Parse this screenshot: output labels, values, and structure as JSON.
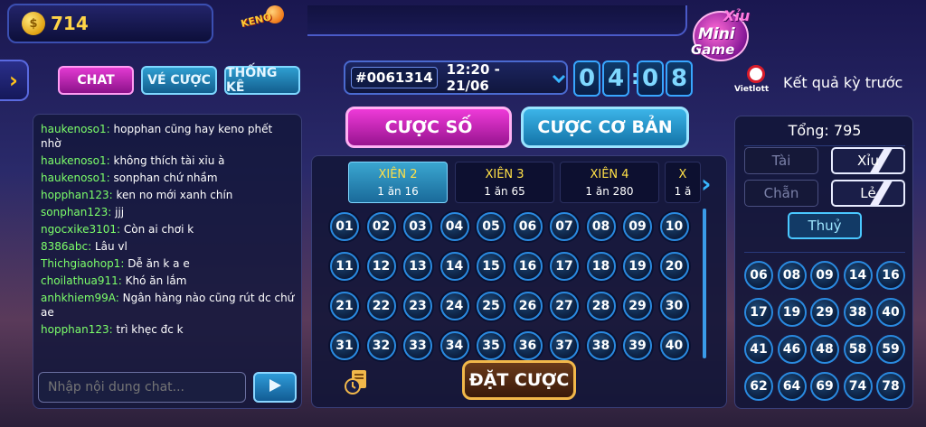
{
  "wallet": {
    "balance": "714",
    "coin_symbol": "$"
  },
  "logos": {
    "keno": "KENO",
    "mini_xiu": "Xỉu",
    "mini_mini": "Mini",
    "mini_game": "Game",
    "vietlott": "Vietlott"
  },
  "tabs": {
    "chat": "CHAT",
    "ve_cuoc": "VÉ CƯỢC",
    "thong_ke": "THỐNG KÊ"
  },
  "round": {
    "id": "#0061314",
    "time": "12:20 - 21/06",
    "timer": [
      "0",
      "4",
      "0",
      "8"
    ]
  },
  "previous_result_label": "Kết quả kỳ trước",
  "chat": {
    "messages": [
      {
        "user": "haukenoso1:",
        "text": " hopphan cũng hay keno phết nhờ"
      },
      {
        "user": "haukenoso1:",
        "text": " không thích tài xỉu à"
      },
      {
        "user": "haukenoso1:",
        "text": " sonphan chứ nhầm"
      },
      {
        "user": "hopphan123:",
        "text": " ken no mới xanh chín"
      },
      {
        "user": "sonphan123:",
        "text": " jjj"
      },
      {
        "user": "ngocxike3101:",
        "text": " Còn ai chơi k"
      },
      {
        "user": "8386abc:",
        "text": " Lâu vl"
      },
      {
        "user": "Thichgiaohop1:",
        "text": " Dễ ăn k a e"
      },
      {
        "user": "choilathua911:",
        "text": " Khó ăn lắm"
      },
      {
        "user": "anhkhiem99A:",
        "text": " Ngân hàng nào cũng rút dc chứ ae"
      },
      {
        "user": "hopphan123:",
        "text": " trì khẹc đc k"
      }
    ],
    "input_placeholder": "Nhập nội dung chat...",
    "input_value": ""
  },
  "bet_modes": {
    "so": "CƯỢC SỐ",
    "co_ban": "CƯỢC CƠ BẢN"
  },
  "xien_tabs": [
    {
      "name": "XIÊN 2",
      "odds": "1 ăn 16",
      "active": true
    },
    {
      "name": "XIÊN 3",
      "odds": "1 ăn 65",
      "active": false
    },
    {
      "name": "XIÊN 4",
      "odds": "1 ăn 280",
      "active": false
    },
    {
      "name": "X",
      "odds": "1 ă",
      "active": false
    }
  ],
  "numbers": [
    "01",
    "02",
    "03",
    "04",
    "05",
    "06",
    "07",
    "08",
    "09",
    "10",
    "11",
    "12",
    "13",
    "14",
    "15",
    "16",
    "17",
    "18",
    "19",
    "20",
    "21",
    "22",
    "23",
    "24",
    "25",
    "26",
    "27",
    "28",
    "29",
    "30",
    "31",
    "32",
    "33",
    "34",
    "35",
    "36",
    "37",
    "38",
    "39",
    "40"
  ],
  "place_bet": "ĐẶT CƯỢC",
  "results": {
    "total": "Tổng: 795",
    "outcomes": [
      {
        "label": "Tài",
        "state": "off"
      },
      {
        "label": "Xỉu",
        "state": "on"
      },
      {
        "label": "Chẵn",
        "state": "off"
      },
      {
        "label": "Lẻ",
        "state": "on"
      },
      {
        "label": "Thuỷ",
        "state": "thuy"
      }
    ],
    "balls": [
      "06",
      "08",
      "09",
      "14",
      "16",
      "17",
      "19",
      "29",
      "38",
      "40",
      "41",
      "46",
      "48",
      "58",
      "59",
      "62",
      "64",
      "69",
      "74",
      "78"
    ]
  },
  "colors": {
    "accent_magenta": "#e23ad1",
    "accent_blue": "#2f9ed0",
    "gold": "#ffd447",
    "username_green": "#7cff6a"
  }
}
